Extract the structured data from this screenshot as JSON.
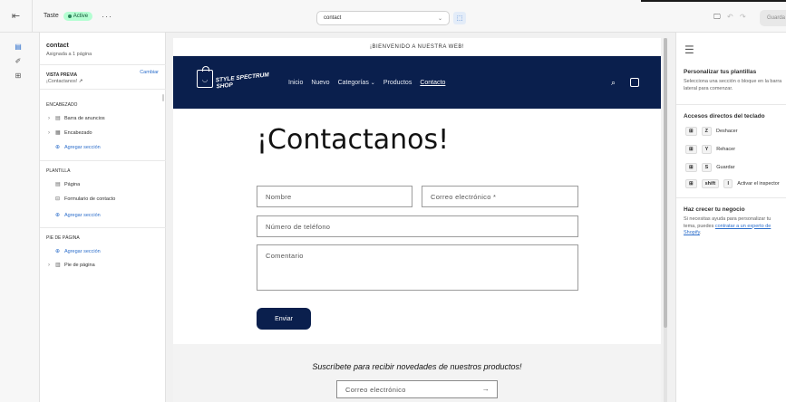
{
  "topbar": {
    "exit_icon": "exit-icon",
    "theme_name": "Taste",
    "status_badge": "Active",
    "more_label": "···",
    "page_select_value": "contact",
    "save_label": "Guarda"
  },
  "sidebar": {
    "template_title": "contact",
    "template_assigned": "Asignada a 1 página",
    "preview_caption": "VISTA PREVIA",
    "preview_value": "¡Contactanos!",
    "change_label": "Cambiar",
    "header_group_caption": "ENCABEZADO",
    "header_items": [
      "Barra de anuncios",
      "Encabezado"
    ],
    "template_caption": "PLANTILLA",
    "template_items": [
      "Página",
      "Formulario de contacto"
    ],
    "footer_caption": "PIE DE PÁGINA",
    "footer_items": [
      "Pie de página"
    ],
    "add_section_label": "Agregar sección"
  },
  "preview": {
    "announcement": "¡BIENVENIDO A NUESTRA WEB!",
    "logo_text": "STYLE SPECTRUM SHOP",
    "nav": [
      "Inicio",
      "Nuevo",
      "Categorías",
      "Productos",
      "Contacto"
    ],
    "nav_dropdown_chevron": "⌄",
    "heading": "¡Contactanos!",
    "form": {
      "name_placeholder": "Nombre",
      "email_placeholder": "Correo electrónico *",
      "phone_placeholder": "Número de teléfono",
      "comment_placeholder": "Comentario",
      "submit_label": "Enviar"
    },
    "newsletter": {
      "heading": "Suscríbete para recibir novedades de nuestros productos!",
      "email_placeholder": "Correo electrónico"
    }
  },
  "right_panel": {
    "customize_title": "Personalizar tus plantillas",
    "customize_text": "Selecciona una sección o bloque en la barra lateral para comenzar.",
    "shortcuts_title": "Accesos directos del teclado",
    "shortcuts": [
      {
        "key": "Z",
        "label": "Deshacer"
      },
      {
        "key": "Y",
        "label": "Rehacer"
      },
      {
        "key": "S",
        "label": "Guardar"
      }
    ],
    "inspector_shortcut": {
      "shift": "shift",
      "key": "I",
      "label": "Activar el inspector"
    },
    "grow_title": "Haz crecer tu negocio",
    "grow_text_before": "Si necesitas ayuda para personalizar tu tema, puedes",
    "grow_link": "contratar a un experto de Shopify",
    "grow_text_after": "."
  },
  "colors": {
    "accent_blue": "#2c6ecb",
    "store_navy": "#0a1f4d",
    "active_badge_bg": "#b4fed2"
  }
}
